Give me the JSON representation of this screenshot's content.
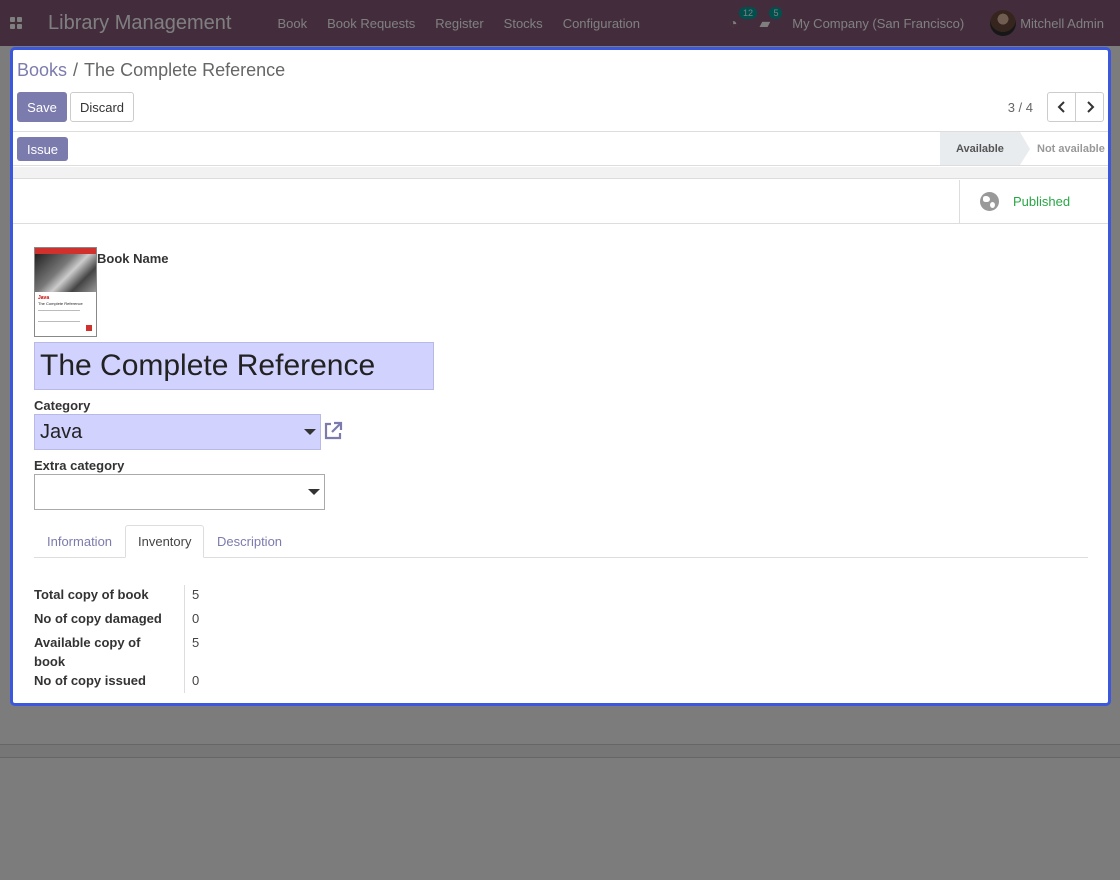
{
  "topbar": {
    "brand": "Library Management",
    "menu": [
      "Book",
      "Book Requests",
      "Register",
      "Stocks",
      "Configuration"
    ],
    "activity_count": "12",
    "message_count": "5",
    "company": "My Company (San Francisco)",
    "user": "Mitchell Admin",
    "icons": [
      "apps-grid-icon",
      "clock-icon",
      "chat-icon",
      "avatar"
    ]
  },
  "breadcrumb": {
    "parent": "Books",
    "separator": "/",
    "current": "The Complete Reference"
  },
  "actions": {
    "save_label": "Save",
    "discard_label": "Discard"
  },
  "pager": {
    "text": "3 / 4"
  },
  "statusbar": {
    "issue_label": "Issue",
    "stages": [
      "Available",
      "Not available"
    ],
    "active_stage": "Available"
  },
  "buttonbox": {
    "published_label": "Published"
  },
  "form": {
    "book_name_label": "Book Name",
    "book_name_value": "The Complete Reference",
    "category_label": "Category",
    "category_value": "Java",
    "extra_category_label": "Extra category",
    "extra_category_value": ""
  },
  "cover": {
    "title": "Java",
    "subtitle": "The Complete Reference"
  },
  "tabs": [
    "Information",
    "Inventory",
    "Description"
  ],
  "active_tab": "Inventory",
  "inventory": [
    {
      "label": "Total copy of book",
      "value": "5"
    },
    {
      "label": "No of copy damaged",
      "value": "0"
    },
    {
      "label": "Available copy of book",
      "value": "5"
    },
    {
      "label": "No of copy issued",
      "value": "0"
    }
  ],
  "colors": {
    "brand": "#875a7b",
    "accent": "#7c7bad",
    "published": "#28a745",
    "dialog_border": "#3b57e0",
    "required_field": "#d2d2ff"
  }
}
